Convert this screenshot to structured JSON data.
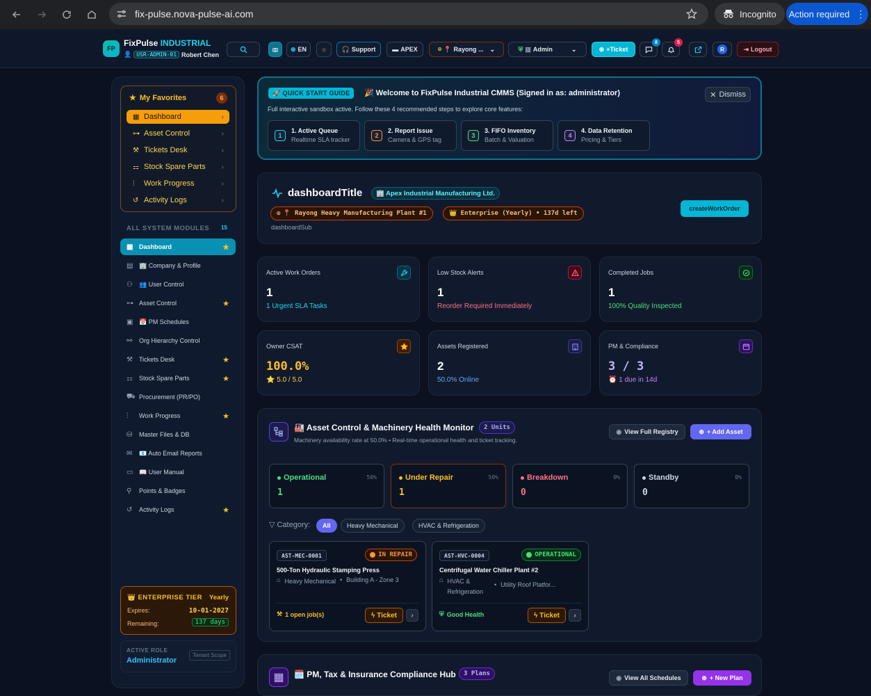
{
  "browser": {
    "url": "fix-pulse.nova-pulse-ai.com",
    "incognito_label": "Incognito",
    "action_label": "Action required"
  },
  "header": {
    "logo": "FP",
    "brand": "FixPulse",
    "brand_suffix": "INDUSTRIAL",
    "user_id": "USR-ADMIN-01",
    "user_name": "Robert Chen",
    "lang": "EN",
    "support": "Support",
    "tenant": "APEX",
    "site": "Rayong ...",
    "role": "Admin",
    "new_ticket": "+Ticket",
    "messages_count": "8",
    "notifications_count": "5",
    "avatar": "R",
    "logout": "Logout"
  },
  "sidebar": {
    "favorites_title": "My Favorites",
    "favorites_count": "6",
    "favorites": [
      {
        "label": "Dashboard",
        "icon": "dashboard-icon"
      },
      {
        "label": "Asset Control",
        "icon": "hierarchy-icon"
      },
      {
        "label": "Tickets Desk",
        "icon": "wrench-icon"
      },
      {
        "label": "Stock Spare Parts",
        "icon": "boxes-icon"
      },
      {
        "label": "Work Progress",
        "icon": "progress-icon"
      },
      {
        "label": "Activity Logs",
        "icon": "history-icon"
      }
    ],
    "modules_title": "ALL SYSTEM MODULES",
    "modules_count": "15",
    "modules": [
      {
        "label": "Dashboard",
        "fav": true
      },
      {
        "label": "🏢 Company & Profile",
        "fav": false
      },
      {
        "label": "👥 User Control",
        "fav": false
      },
      {
        "label": "Asset Control",
        "fav": true
      },
      {
        "label": "📅 PM Schedules",
        "fav": false
      },
      {
        "label": "Org Hierarchy Control",
        "fav": false
      },
      {
        "label": "Tickets Desk",
        "fav": true
      },
      {
        "label": "Stock Spare Parts",
        "fav": true
      },
      {
        "label": "Procurement (PR/PO)",
        "fav": false
      },
      {
        "label": "Work Progress",
        "fav": true
      },
      {
        "label": "Master Files & DB",
        "fav": false
      },
      {
        "label": "📧 Auto Email Reports",
        "fav": false
      },
      {
        "label": "📖 User Manual",
        "fav": false
      },
      {
        "label": "Points & Badges",
        "fav": false
      },
      {
        "label": "Activity Logs",
        "fav": true
      }
    ],
    "enterprise": {
      "title": "ENTERPRISE TIER",
      "cycle": "Yearly",
      "expires_label": "Expires:",
      "expires": "10-01-2027",
      "remaining_label": "Remaining:",
      "remaining": "137 days"
    },
    "role": {
      "label": "ACTIVE ROLE",
      "value": "Administrator",
      "scope": "Tenant Scope"
    }
  },
  "quickstart": {
    "tag": "QUICK START GUIDE",
    "title": "🎉 Welcome to FixPulse Industrial CMMS (Signed in as: administrator)",
    "subtitle": "Full interactive sandbox active. Follow these 4 recommended steps to explore core features:",
    "dismiss": "Dismiss",
    "steps": [
      {
        "num": "1",
        "title": "1. Active Queue",
        "sub": "Realtime SLA tracker",
        "color": "#22d3ee"
      },
      {
        "num": "2",
        "title": "2. Report Issue",
        "sub": "Camera & GPS tag",
        "color": "#fb923c"
      },
      {
        "num": "3",
        "title": "3. FIFO Inventory",
        "sub": "Batch & Valuation",
        "color": "#4ade80"
      },
      {
        "num": "4",
        "title": "4. Data Retention",
        "sub": "Pricing & Tiers",
        "color": "#c084fc"
      }
    ]
  },
  "dashboard": {
    "title": "dashboardTitle",
    "company": "🏢 Apex Industrial Manufacturing Ltd.",
    "plant": "📍 Rayong Heavy Manufacturing Plant #1",
    "plan": "👑 Enterprise (Yearly) • 137d left",
    "sub": "dashboardSub",
    "create_btn": "createWorkOrder"
  },
  "stats": [
    {
      "label": "Active Work Orders",
      "value": "1",
      "sub": "1 Urgent SLA Tasks",
      "sub_color": "#22d3ee",
      "icon": "wrench-icon",
      "icon_color": "#22d3ee",
      "icon_bg": "#083344"
    },
    {
      "label": "Low Stock Alerts",
      "value": "1",
      "sub": "Reorder Required Immediately",
      "sub_color": "#fb7185",
      "icon": "warning-icon",
      "icon_color": "#fb7185",
      "icon_bg": "#4c0519"
    },
    {
      "label": "Completed Jobs",
      "value": "1",
      "sub": "100% Quality Inspected",
      "sub_color": "#4ade80",
      "icon": "check-circle-icon",
      "icon_color": "#4ade80",
      "icon_bg": "#052e16"
    },
    {
      "label": "Owner CSAT",
      "value": "100.0%",
      "sub": "⭐ 5.0 / 5.0",
      "sub_color": "#fcd34d",
      "icon": "star-icon",
      "icon_color": "#fbbf24",
      "icon_bg": "#451a03",
      "value_color": "#fbbf24"
    },
    {
      "label": "Assets Registered",
      "value": "2",
      "sub": "50.0% Online",
      "sub_color": "#60a5fa",
      "icon": "building-icon",
      "icon_color": "#818cf8",
      "icon_bg": "#1e1b4b"
    },
    {
      "label": "PM & Compliance",
      "value": "3 / 3",
      "sub": "⏰ 1 due in 14d",
      "sub_color": "#c084fc",
      "icon": "calendar-icon",
      "icon_color": "#c084fc",
      "icon_bg": "#2e1065",
      "value_color": "#c4b5fd"
    }
  ],
  "assets": {
    "title": "🏭 Asset Control & Machinery Health Monitor",
    "units": "2 Units",
    "sub": "Machinery availability rate at 50.0% • Real-time operational health and ticket tracking.",
    "view_btn": "View Full Registry",
    "add_btn": "+ Add Asset",
    "statuses": [
      {
        "name": "Operational",
        "pct": "50%",
        "count": "1",
        "color": "#4ade80",
        "border": "#334155"
      },
      {
        "name": "Under Repair",
        "pct": "50%",
        "count": "1",
        "color": "#fbbf24",
        "border": "#78350f"
      },
      {
        "name": "Breakdown",
        "pct": "0%",
        "count": "0",
        "color": "#fb7185",
        "border": "#334155"
      },
      {
        "name": "Standby",
        "pct": "0%",
        "count": "0",
        "color": "#cbd5e1",
        "border": "#334155"
      }
    ],
    "category_label": "Category:",
    "categories": [
      "All",
      "Heavy Mechanical",
      "HVAC & Refrigeration"
    ],
    "cards": [
      {
        "code": "AST-MEC-0001",
        "status": "IN REPAIR",
        "status_color": "#fb923c",
        "status_bg": "#2a1406",
        "status_border": "#c2410c",
        "name": "500-Ton Hydraulic Stamping Press",
        "cat": "Heavy Mechanical",
        "loc": "Building A - Zone 3",
        "foot": "1 open job(s)",
        "foot_color": "#fbbf24",
        "ticket": "Ticket"
      },
      {
        "code": "AST-HVC-0004",
        "status": "OPERATIONAL",
        "status_color": "#4ade80",
        "status_bg": "#052e16",
        "status_border": "#15803d",
        "name": "Centrifugal Water Chiller Plant #2",
        "cat": "HVAC &",
        "cat2": "Refrigeration",
        "loc": "Utility Roof Platfor...",
        "foot": "Good Health",
        "foot_color": "#4ade80",
        "ticket": "Ticket"
      }
    ]
  },
  "pm": {
    "title": "🗓️ PM, Tax & Insurance Compliance Hub",
    "plans": "3 Plans",
    "view_btn": "View All Schedules",
    "new_btn": "+ New Plan"
  }
}
